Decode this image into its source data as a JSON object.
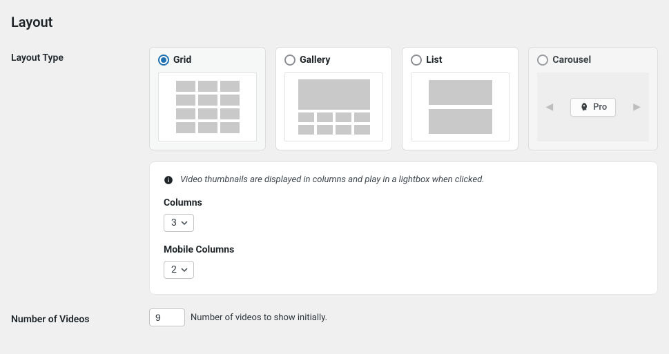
{
  "section_title": "Layout",
  "layout_type": {
    "label": "Layout Type",
    "options": {
      "grid": "Grid",
      "gallery": "Gallery",
      "list": "List",
      "carousel": "Carousel"
    },
    "pro_label": "Pro",
    "hint": "Video thumbnails are displayed in columns and play in a lightbox when clicked.",
    "columns": {
      "label": "Columns",
      "value": "3"
    },
    "mobile_columns": {
      "label": "Mobile Columns",
      "value": "2"
    }
  },
  "num_videos": {
    "label": "Number of Videos",
    "value": "9",
    "desc": "Number of videos to show initially."
  }
}
